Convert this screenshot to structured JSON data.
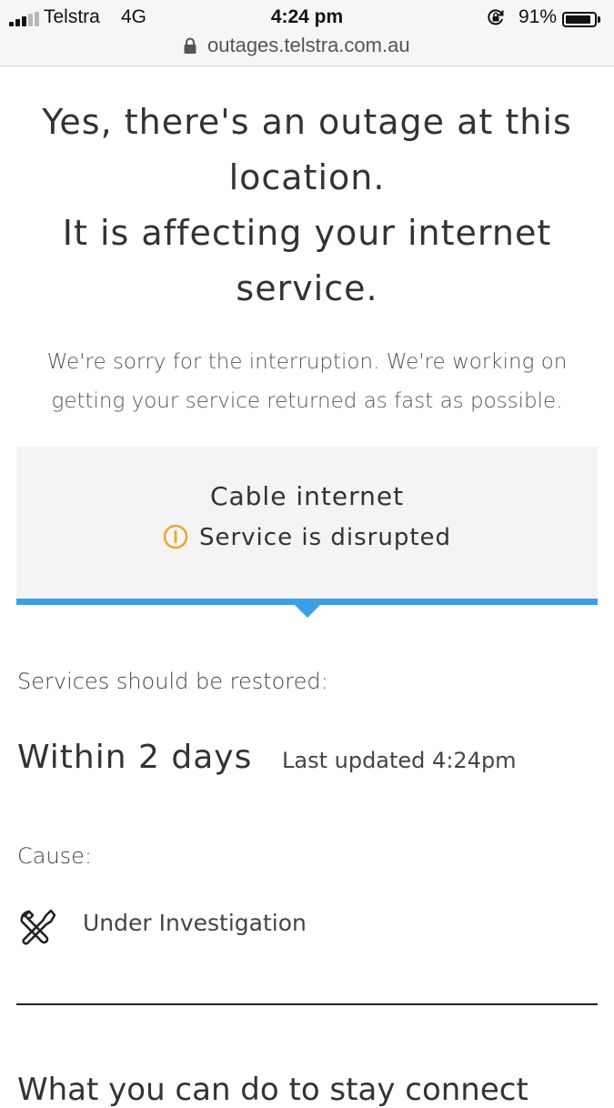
{
  "status_bar": {
    "carrier": "Telstra",
    "network": "4G",
    "time": "4:24 pm",
    "battery_percent": "91%",
    "battery_level": 0.91,
    "signal_bars_filled": 3,
    "signal_bars_total": 5,
    "rotation_lock_icon": "rotation-lock-icon"
  },
  "url_bar": {
    "lock_icon": "lock-icon",
    "url": "outages.telstra.com.au"
  },
  "outage": {
    "headline_line1": "Yes, there's an outage at this",
    "headline_line2": "location.",
    "headline_line3": "It is affecting your internet",
    "headline_line4": "service.",
    "apology_line1": "We're sorry for the interruption. We're working on",
    "apology_line2": "getting your service returned as fast as possible."
  },
  "status_card": {
    "service": "Cable internet",
    "status": "Service is disrupted",
    "status_icon": "warning-icon",
    "warning_color": "#f0a43a",
    "accent_color": "#3aa0e6"
  },
  "restoration": {
    "label": "Services should be restored:",
    "eta": "Within 2 days",
    "last_updated": "Last updated 4:24pm"
  },
  "cause": {
    "label": "Cause:",
    "icon": "tools-icon",
    "value": "Under Investigation"
  },
  "next_section": {
    "heading": "What you can do to stay connect"
  }
}
